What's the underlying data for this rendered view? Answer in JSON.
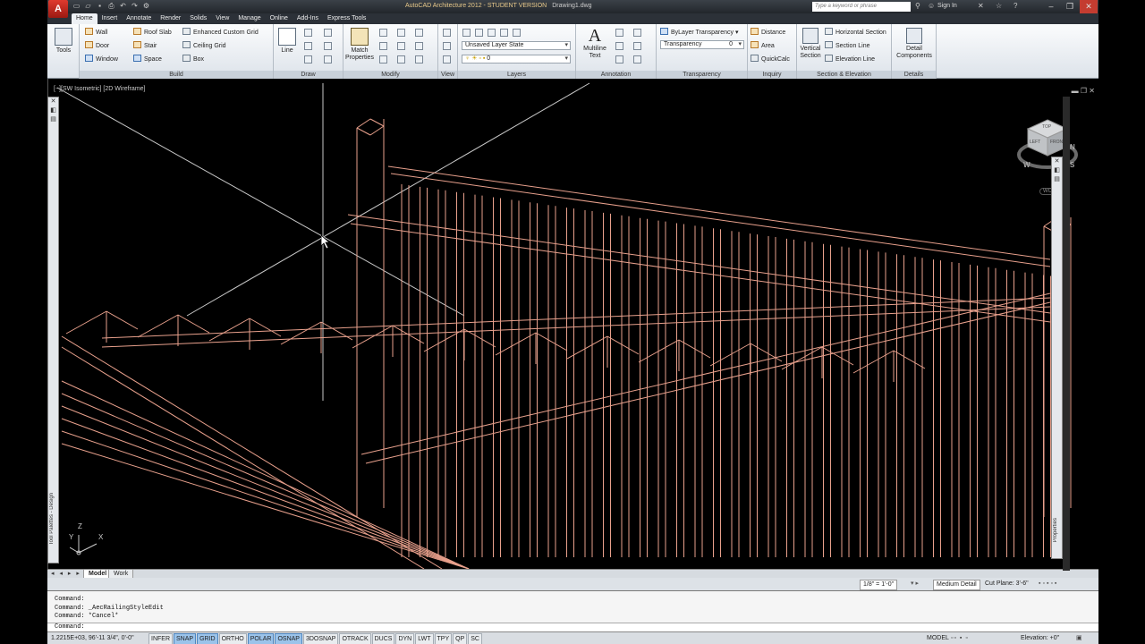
{
  "app": {
    "title": "AutoCAD Architecture 2012 - STUDENT VERSION",
    "filename": "Drawing1.dwg",
    "logo": "A",
    "search_placeholder": "Type a keyword or phrase",
    "signin": "Sign In"
  },
  "tabs": [
    "Home",
    "Insert",
    "Annotate",
    "Render",
    "Solids",
    "View",
    "Manage",
    "Online",
    "Add-Ins",
    "Express Tools"
  ],
  "ribbon": {
    "tools": {
      "label": "Tools"
    },
    "build": {
      "title": "Build",
      "items": [
        "Wall",
        "Door",
        "Window",
        "Roof Slab",
        "Stair",
        "Space",
        "Enhanced Custom Grid",
        "Ceiling Grid",
        "Box"
      ]
    },
    "draw": {
      "title": "Draw",
      "line": "Line"
    },
    "modify": {
      "title": "Modify",
      "match": "Match Properties"
    },
    "view": {
      "title": "View"
    },
    "layers": {
      "title": "Layers",
      "state": "Unsaved Layer State",
      "current": "0"
    },
    "annotation": {
      "title": "Annotation",
      "multiline": "Multiline Text"
    },
    "transparency": {
      "title": "Transparency",
      "bylayer": "ByLayer Transparency",
      "label": "Transparency",
      "value": "0"
    },
    "inquiry": {
      "title": "Inquiry",
      "distance": "Distance",
      "area": "Area",
      "quickcalc": "QuickCalc"
    },
    "section": {
      "title": "Section & Elevation",
      "vertical": "Vertical Section",
      "horizontal": "Horizontal Section",
      "line": "Section Line",
      "elevation": "Elevation Line"
    },
    "details": {
      "title": "Details",
      "components": "Detail Components"
    }
  },
  "viewport": {
    "label": "[−][SW Isometric] [2D Wireframe]",
    "tool_palettes": "Tool Palettes - Design",
    "properties": "Properties",
    "viewcube_top": "TOP",
    "viewcube_left": "LEFT",
    "viewcube_front": "FRONT",
    "compass_w": "W",
    "compass_s": "S",
    "compass_n": "N",
    "wcs": "WCS",
    "ucs_x": "X",
    "ucs_y": "Y",
    "ucs_z": "Z"
  },
  "layout_tabs": {
    "nav": "◂ ◂ ▸ ▸",
    "model": "Model",
    "work": "Work"
  },
  "scale_bar": {
    "scale": "1/8\" = 1'-0\"",
    "detail": "Medium Detail",
    "cut_plane": "Cut Plane: 3'-6\""
  },
  "command_lines": [
    "Command:",
    "Command: _AecRailingStyleEdit",
    "Command: *Cancel*",
    "Command:"
  ],
  "status": {
    "coords": "1.2215E+03, 96'-11 3/4\", 0'-0\"",
    "toggles": [
      {
        "label": "INFER",
        "on": false
      },
      {
        "label": "SNAP",
        "on": true
      },
      {
        "label": "GRID",
        "on": true
      },
      {
        "label": "ORTHO",
        "on": false
      },
      {
        "label": "POLAR",
        "on": true
      },
      {
        "label": "OSNAP",
        "on": true
      },
      {
        "label": "3DOSNAP",
        "on": false
      },
      {
        "label": "OTRACK",
        "on": false
      },
      {
        "label": "DUCS",
        "on": false
      },
      {
        "label": "DYN",
        "on": false
      },
      {
        "label": "LWT",
        "on": false
      },
      {
        "label": "TPY",
        "on": false
      },
      {
        "label": "QP",
        "on": false
      },
      {
        "label": "SC",
        "on": false
      }
    ],
    "model": "MODEL",
    "elevation": "Elevation: +0\""
  },
  "colors": {
    "wire": "#e8a08c",
    "wire_dim": "#c8c8c8",
    "accent": "#9bc3ea"
  }
}
